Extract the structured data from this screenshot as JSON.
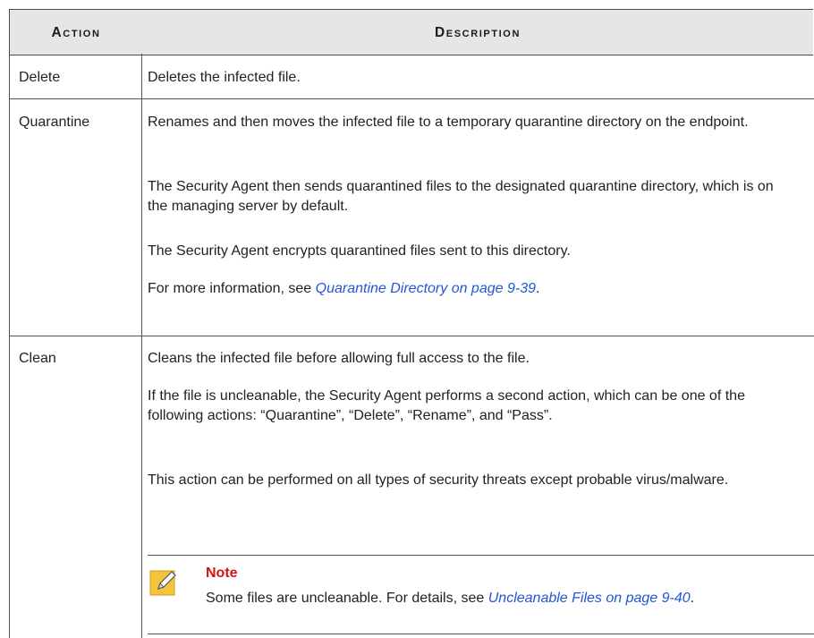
{
  "header": {
    "action": "Action",
    "description": "Description"
  },
  "rows": [
    {
      "action": "Delete",
      "paragraphs": [
        "Deletes the infected file."
      ]
    },
    {
      "action": "Quarantine",
      "paragraphs": [
        "Renames and then moves the infected file to a temporary quarantine directory on the endpoint.",
        "The Security Agent then sends quarantined files to the designated quarantine directory, which is on the managing server by default.",
        "The Security Agent encrypts quarantined files sent to this directory."
      ],
      "more_info_prefix": "For more information, see ",
      "more_info_link": "Quarantine Directory on page 9-39",
      "more_info_suffix": "."
    },
    {
      "action": "Clean",
      "paragraphs": [
        "Cleans the infected file before allowing full access to the file.",
        "If the file is uncleanable, the Security Agent performs a second action, which can be one of the following actions: “Quarantine”, “Delete”, “Rename”, and “Pass”.",
        "This action can be performed on all types of security threats except probable virus/malware."
      ]
    }
  ],
  "note": {
    "title": "Note",
    "text_prefix": "Some files are uncleanable. For details, see ",
    "link": "Uncleanable Files on page 9-40",
    "text_suffix": "."
  },
  "colors": {
    "header_bg": "#e6e6e6",
    "border": "#555555",
    "link": "#2255d8",
    "note_title": "#d21414",
    "note_icon": "#f2c53d"
  },
  "icons": {
    "note": "note-pencil-icon"
  }
}
